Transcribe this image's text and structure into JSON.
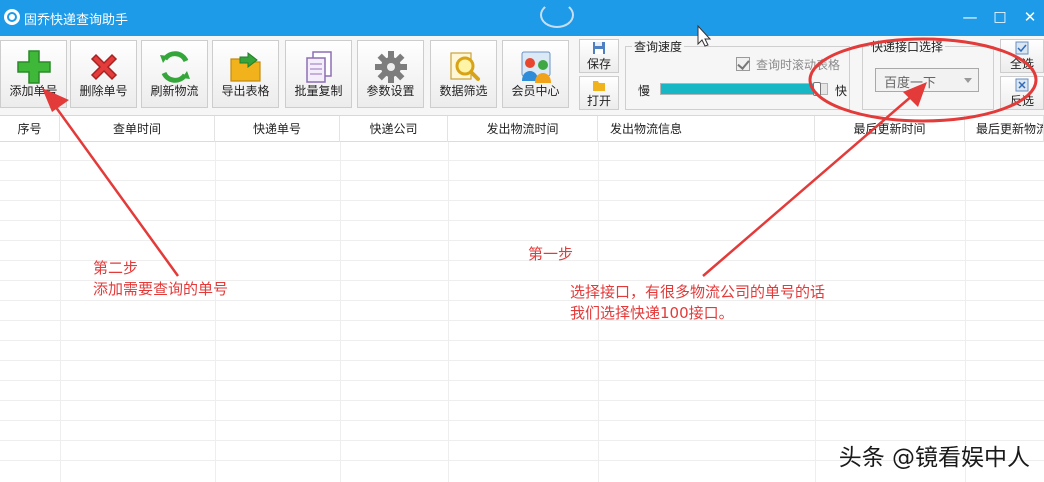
{
  "window": {
    "title": "固乔快递查询助手",
    "minimize": "—",
    "maximize": "□",
    "close": "✕"
  },
  "toolbar": {
    "add": "添加单号",
    "delete": "删除单号",
    "refresh": "刷新物流",
    "export": "导出表格",
    "batch_copy": "批量复制",
    "settings": "参数设置",
    "filter": "数据筛选",
    "member": "会员中心",
    "save": "保存",
    "open": "打开",
    "select_all": "全选",
    "invert": "反选"
  },
  "query_speed": {
    "title": "查询速度",
    "scroll_checkbox_label": "查询时滚动表格",
    "scroll_checked": true,
    "slow_label": "慢",
    "fast_label": "快",
    "level": 0.45
  },
  "interface": {
    "title": "快递接口选择",
    "selected": "百度一下"
  },
  "table": {
    "columns": [
      "序号",
      "查单时间",
      "快递单号",
      "快递公司",
      "发出物流时间",
      "发出物流信息",
      "最后更新时间",
      "最后更新物流"
    ]
  },
  "annotations": {
    "step2_title": "第二步",
    "step2_text": "添加需要查询的单号",
    "step1_title": "第一步",
    "step1_line1": "选择接口，有很多物流公司的单号的话",
    "step1_line2": "我们选择快递100接口。"
  },
  "watermark": "头条 @镜看娱中人",
  "colors": {
    "titlebar": "#1e9be8",
    "annotation": "#e33a3a",
    "slider_fill": "#17b7c6"
  }
}
